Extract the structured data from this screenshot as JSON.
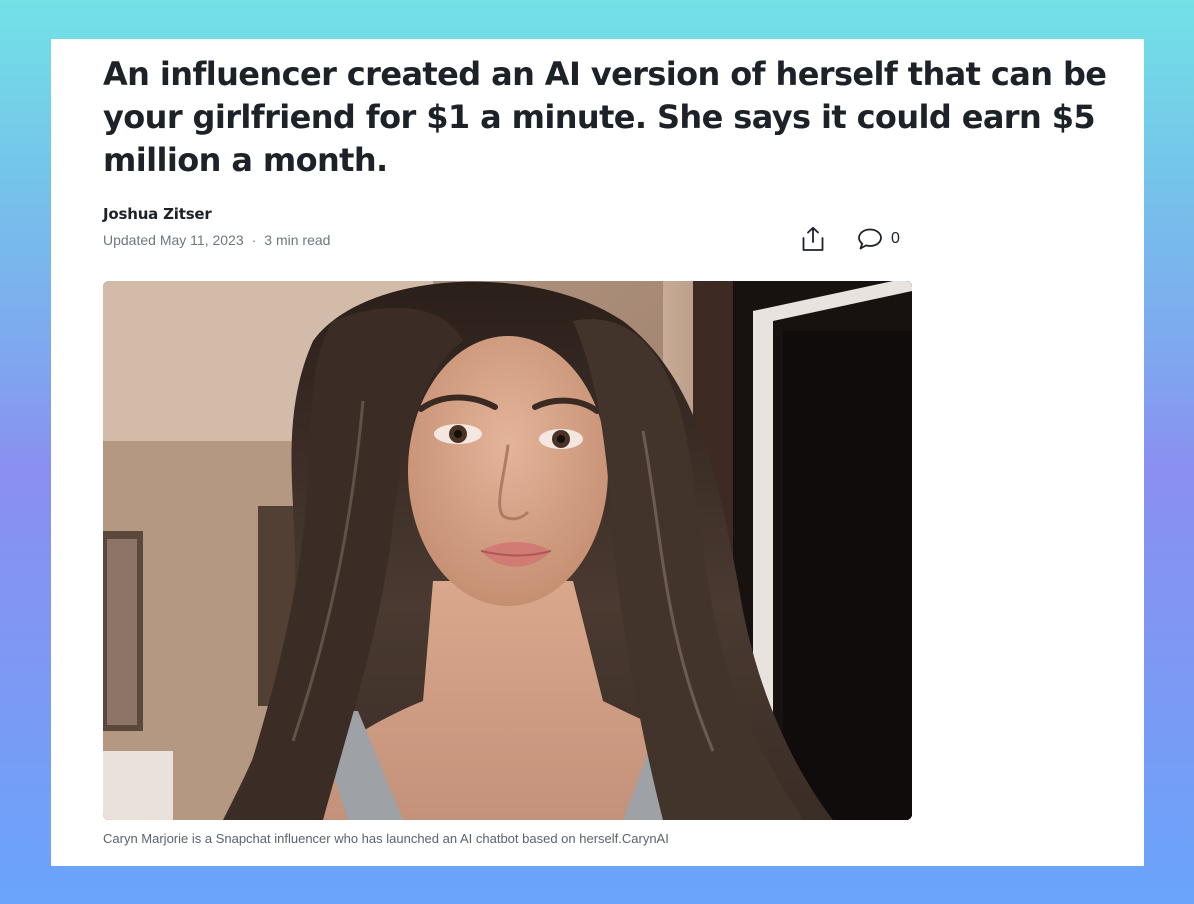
{
  "article": {
    "headline": "An influencer created an AI version of herself that can be your girlfriend for $1 a minute. She says it could earn $5 million a month.",
    "author": "Joshua Zitser",
    "updated": "Updated May 11, 2023",
    "separator": "·",
    "read_time": "3 min read",
    "comment_count": "0",
    "image_caption": "Caryn Marjorie is a Snapchat influencer who has launched an AI chatbot based on herself.CarynAI"
  },
  "icons": {
    "share": "share-icon",
    "comment": "comment-icon"
  },
  "colors": {
    "text_primary": "#1d2228",
    "text_secondary": "#6e7780",
    "card_background": "#ffffff"
  }
}
